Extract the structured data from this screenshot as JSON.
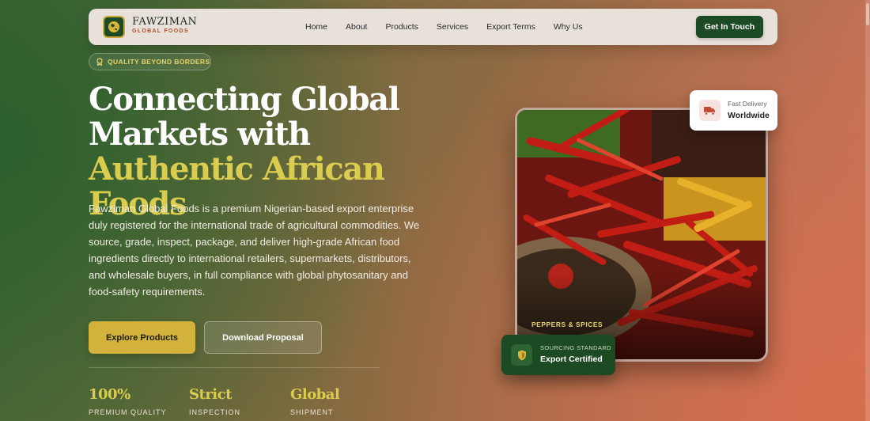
{
  "brand": {
    "name": "FAWZIMAN",
    "tagline": "GLOBAL FOODS",
    "icon": "globe-icon"
  },
  "nav": {
    "links": [
      "Home",
      "About",
      "Products",
      "Services",
      "Export Terms",
      "Why Us"
    ],
    "cta": "Get In Touch"
  },
  "hero": {
    "badge": "QUALITY BEYOND BORDERS",
    "badge_icon": "award-icon",
    "headline_part1": "Connecting Global Markets with ",
    "headline_accent": "Authentic African Foods",
    "description": "Fawziman Global Foods is a premium Nigerian-based export enterprise duly registered for the international trade of agricultural commodities. We source, grade, inspect, package, and deliver high-grade African food ingredients directly to international retailers, supermarkets, distributors, and wholesale buyers, in full compliance with global phytosanitary and food-safety requirements.",
    "primary_button": "Explore Products",
    "secondary_button": "Download Proposal"
  },
  "stats": [
    {
      "value": "100%",
      "label": "PREMIUM QUALITY"
    },
    {
      "value": "Strict",
      "label": "INSPECTION"
    },
    {
      "value": "Global",
      "label": "SHIPMENT"
    }
  ],
  "photo": {
    "caption": "PEPPERS & SPICES"
  },
  "delivery_card": {
    "label": "Fast Delivery",
    "value": "Worldwide",
    "icon": "truck-icon"
  },
  "cert_card": {
    "label": "SOURCING STANDARD",
    "value": "Export Certified",
    "icon": "shield-icon"
  },
  "colors": {
    "brand_green": "#1c4a24",
    "accent_gold": "#d2b23a",
    "headline_accent": "#d9cc4f",
    "badge_text": "#e8d46a"
  }
}
